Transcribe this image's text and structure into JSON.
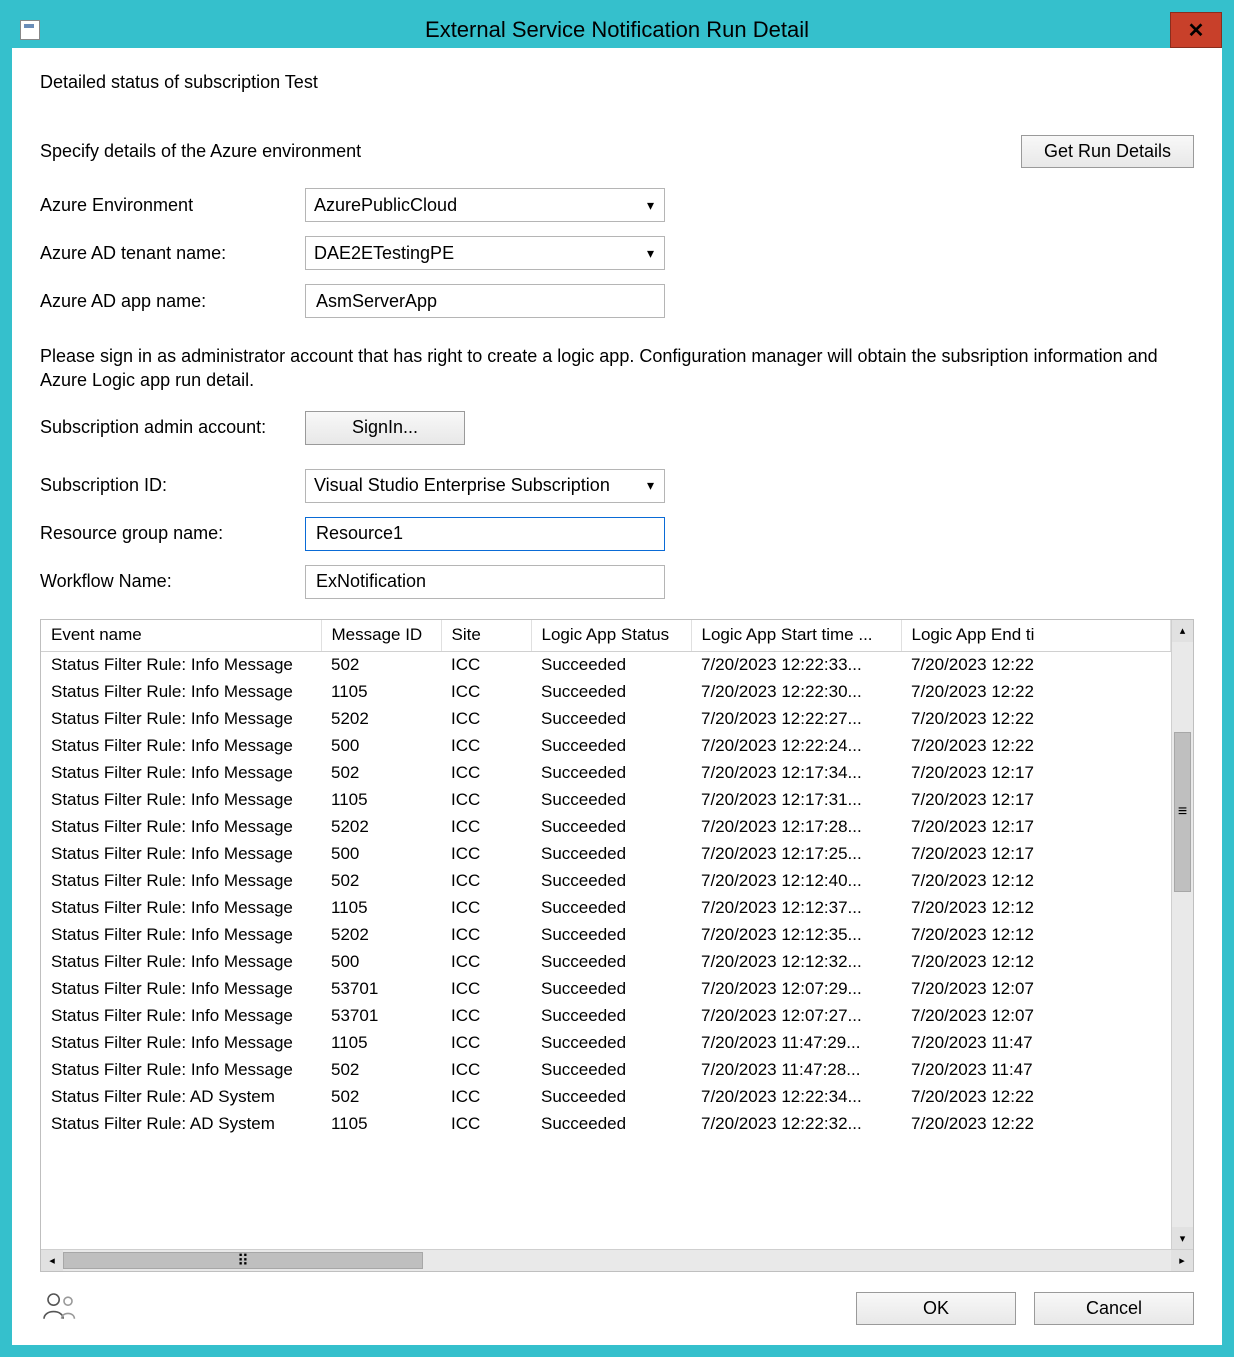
{
  "window": {
    "title": "External Service Notification Run Detail"
  },
  "header": {
    "subtitle": "Detailed status of subscription Test",
    "instruction": "Specify details of the Azure environment",
    "get_run_details_label": "Get Run Details"
  },
  "form": {
    "azure_env_label": "Azure Environment",
    "azure_env_value": "AzurePublicCloud",
    "tenant_label": "Azure AD tenant name:",
    "tenant_value": "DAE2ETestingPE",
    "app_label": "Azure AD app name:",
    "app_value": "AsmServerApp",
    "signin_instruction": "Please sign in as administrator account that has right to create a logic app. Configuration manager will obtain the subsription information and Azure Logic app run detail.",
    "admin_account_label": "Subscription admin account:",
    "signin_label": "SignIn...",
    "subscription_id_label": "Subscription ID:",
    "subscription_id_value": "Visual Studio Enterprise Subscription",
    "resource_group_label": "Resource group name:",
    "resource_group_value": "Resource1",
    "workflow_label": "Workflow Name:",
    "workflow_value": "ExNotification"
  },
  "table": {
    "columns": [
      "Event name",
      "Message ID",
      "Site",
      "Logic App Status",
      "Logic App Start time ...",
      "Logic App End ti"
    ],
    "rows": [
      {
        "event": "Status Filter Rule: Info Message",
        "msgid": "502",
        "site": "ICC",
        "status": "Succeeded",
        "start": "7/20/2023 12:22:33...",
        "end": "7/20/2023 12:22"
      },
      {
        "event": "Status Filter Rule: Info Message",
        "msgid": "1105",
        "site": "ICC",
        "status": "Succeeded",
        "start": "7/20/2023 12:22:30...",
        "end": "7/20/2023 12:22"
      },
      {
        "event": "Status Filter Rule: Info Message",
        "msgid": "5202",
        "site": "ICC",
        "status": "Succeeded",
        "start": "7/20/2023 12:22:27...",
        "end": "7/20/2023 12:22"
      },
      {
        "event": "Status Filter Rule: Info Message",
        "msgid": "500",
        "site": "ICC",
        "status": "Succeeded",
        "start": "7/20/2023 12:22:24...",
        "end": "7/20/2023 12:22"
      },
      {
        "event": "Status Filter Rule: Info Message",
        "msgid": "502",
        "site": "ICC",
        "status": "Succeeded",
        "start": "7/20/2023 12:17:34...",
        "end": "7/20/2023 12:17"
      },
      {
        "event": "Status Filter Rule: Info Message",
        "msgid": "1105",
        "site": "ICC",
        "status": "Succeeded",
        "start": "7/20/2023 12:17:31...",
        "end": "7/20/2023 12:17"
      },
      {
        "event": "Status Filter Rule: Info Message",
        "msgid": "5202",
        "site": "ICC",
        "status": "Succeeded",
        "start": "7/20/2023 12:17:28...",
        "end": "7/20/2023 12:17"
      },
      {
        "event": "Status Filter Rule: Info Message",
        "msgid": "500",
        "site": "ICC",
        "status": "Succeeded",
        "start": "7/20/2023 12:17:25...",
        "end": "7/20/2023 12:17"
      },
      {
        "event": "Status Filter Rule: Info Message",
        "msgid": "502",
        "site": "ICC",
        "status": "Succeeded",
        "start": "7/20/2023 12:12:40...",
        "end": "7/20/2023 12:12"
      },
      {
        "event": "Status Filter Rule: Info Message",
        "msgid": "1105",
        "site": "ICC",
        "status": "Succeeded",
        "start": "7/20/2023 12:12:37...",
        "end": "7/20/2023 12:12"
      },
      {
        "event": "Status Filter Rule: Info Message",
        "msgid": "5202",
        "site": "ICC",
        "status": "Succeeded",
        "start": "7/20/2023 12:12:35...",
        "end": "7/20/2023 12:12"
      },
      {
        "event": "Status Filter Rule: Info Message",
        "msgid": "500",
        "site": "ICC",
        "status": "Succeeded",
        "start": "7/20/2023 12:12:32...",
        "end": "7/20/2023 12:12"
      },
      {
        "event": "Status Filter Rule: Info Message",
        "msgid": "53701",
        "site": "ICC",
        "status": "Succeeded",
        "start": "7/20/2023 12:07:29...",
        "end": "7/20/2023 12:07"
      },
      {
        "event": "Status Filter Rule: Info Message",
        "msgid": "53701",
        "site": "ICC",
        "status": "Succeeded",
        "start": "7/20/2023 12:07:27...",
        "end": "7/20/2023 12:07"
      },
      {
        "event": "Status Filter Rule: Info Message",
        "msgid": "1105",
        "site": "ICC",
        "status": "Succeeded",
        "start": "7/20/2023 11:47:29...",
        "end": "7/20/2023 11:47"
      },
      {
        "event": "Status Filter Rule: Info Message",
        "msgid": "502",
        "site": "ICC",
        "status": "Succeeded",
        "start": "7/20/2023 11:47:28...",
        "end": "7/20/2023 11:47"
      },
      {
        "event": "Status Filter Rule: AD System",
        "msgid": "502",
        "site": "ICC",
        "status": "Succeeded",
        "start": "7/20/2023 12:22:34...",
        "end": "7/20/2023 12:22"
      },
      {
        "event": "Status Filter Rule: AD System",
        "msgid": "1105",
        "site": "ICC",
        "status": "Succeeded",
        "start": "7/20/2023 12:22:32...",
        "end": "7/20/2023 12:22"
      }
    ]
  },
  "footer": {
    "ok_label": "OK",
    "cancel_label": "Cancel"
  }
}
